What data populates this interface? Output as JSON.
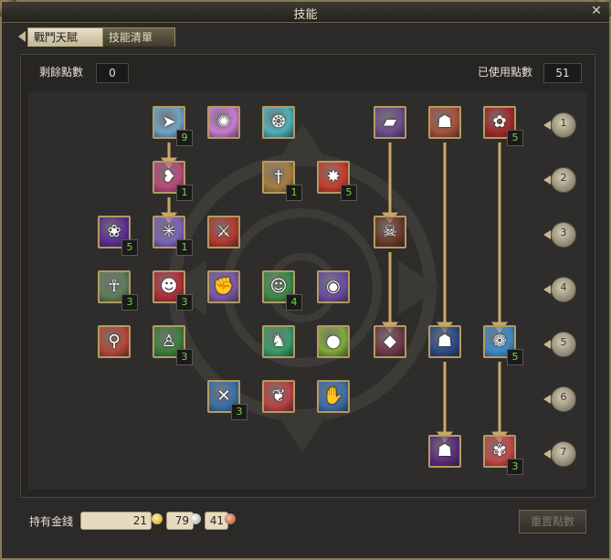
{
  "window": {
    "title": "技能",
    "close_label": "✕"
  },
  "tabs": [
    {
      "label": "戰鬥天賦",
      "active": true
    },
    {
      "label": "技能清單",
      "active": false
    }
  ],
  "points": {
    "remaining_label": "剩餘點數",
    "remaining_value": "0",
    "used_label": "已使用點數",
    "used_value": "51"
  },
  "tree": {
    "rows": [
      "1",
      "2",
      "3",
      "4",
      "5",
      "6",
      "7"
    ],
    "skills": [
      {
        "icon": "arrow-icon",
        "color": "#6fa3c4",
        "count": "9"
      },
      {
        "icon": "pinwheel-icon",
        "color": "#c87bd0",
        "count": ""
      },
      {
        "icon": "paw-cluster-icon",
        "color": "#4fb0b7",
        "count": ""
      },
      {
        "icon": "book-icon",
        "color": "#6c4e8a",
        "count": ""
      },
      {
        "icon": "beast-face-icon",
        "color": "#a5533b",
        "count": ""
      },
      {
        "icon": "paw-icon",
        "color": "#a02a2a",
        "count": "5"
      },
      {
        "icon": "slash-icon",
        "color": "#b84a7a",
        "count": "1"
      },
      {
        "icon": "dagger-icon",
        "color": "#a57d3e",
        "count": "1"
      },
      {
        "icon": "burst-icon",
        "color": "#c43d2c",
        "count": "5"
      },
      {
        "icon": "pawprint-icon",
        "color": "#5b2f8e",
        "count": "5"
      },
      {
        "icon": "shatter-icon",
        "color": "#7b64b8",
        "count": "1"
      },
      {
        "icon": "blade-icon",
        "color": "#b23b2f",
        "count": ""
      },
      {
        "icon": "skull-icon",
        "color": "#6a3a2a",
        "count": ""
      },
      {
        "icon": "skeleton-icon",
        "color": "#5e7d5a",
        "count": "3"
      },
      {
        "icon": "demon-icon",
        "color": "#b02f3b",
        "count": "3"
      },
      {
        "icon": "fist-icon",
        "color": "#7b58a6",
        "count": ""
      },
      {
        "icon": "ghost-icon",
        "color": "#3d8a4a",
        "count": "4"
      },
      {
        "icon": "mask-icon",
        "color": "#6a4ea3",
        "count": ""
      },
      {
        "icon": "pin-icon",
        "color": "#b4483a",
        "count": ""
      },
      {
        "icon": "figure-icon",
        "color": "#3e7e3e",
        "count": "3"
      },
      {
        "icon": "wolf-icon",
        "color": "#3a9a6a",
        "count": ""
      },
      {
        "icon": "orb-icon",
        "color": "#7eaa3a",
        "count": ""
      },
      {
        "icon": "shard-icon",
        "color": "#6e3a4a",
        "count": ""
      },
      {
        "icon": "dark-beast-icon",
        "color": "#2d4b86",
        "count": ""
      },
      {
        "icon": "glow-paw-icon",
        "color": "#3c8ac4",
        "count": "5"
      },
      {
        "icon": "crossed-blades-icon",
        "color": "#3b6fa6",
        "count": "3"
      },
      {
        "icon": "twist-icon",
        "color": "#b84444",
        "count": ""
      },
      {
        "icon": "claw-icon",
        "color": "#3d6fa8",
        "count": ""
      },
      {
        "icon": "purple-beast-icon",
        "color": "#5a2d7a",
        "count": ""
      },
      {
        "icon": "spotted-paw-icon",
        "color": "#c04848",
        "count": "3"
      }
    ]
  },
  "money": {
    "label": "持有金錢",
    "gold": "21",
    "silver": "79",
    "copper": "41",
    "colors": {
      "gold": "#e1b23b",
      "silver": "#b9b9b9",
      "copper": "#c56b4a"
    }
  },
  "reset_label": "重置點數"
}
